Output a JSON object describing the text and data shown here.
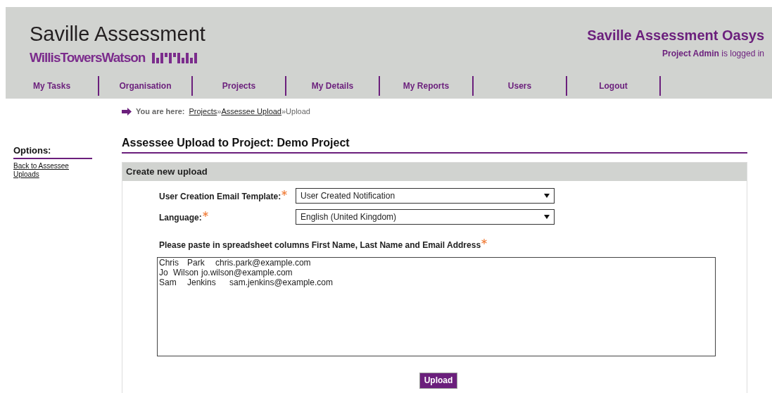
{
  "header": {
    "brand": "Saville Assessment",
    "sub_brand": "WillisTowersWatson",
    "product": "Saville Assessment Oasys",
    "user": "Project Admin",
    "user_suffix": "is logged in"
  },
  "nav": [
    {
      "label": "My Tasks"
    },
    {
      "label": "Organisation"
    },
    {
      "label": "Projects"
    },
    {
      "label": "My Details"
    },
    {
      "label": "My Reports"
    },
    {
      "label": "Users"
    },
    {
      "label": "Logout"
    }
  ],
  "breadcrumb": {
    "prefix": "You are here:",
    "links": [
      "Projects",
      "Assessee Upload"
    ],
    "current": "Upload",
    "separator": "»"
  },
  "sidebar": {
    "title": "Options:",
    "links": [
      "Back to Assessee Uploads"
    ]
  },
  "page_title": "Assessee Upload to Project: Demo Project",
  "panel": {
    "title": "Create new upload",
    "fields": [
      {
        "label": "User Creation Email Template:",
        "required": true,
        "value": "User Created Notification"
      },
      {
        "label": "Language:",
        "required": true,
        "value": "English (United Kingdom)"
      }
    ],
    "paste_label": "Please paste in spreadsheet columns First Name, Last Name and Email Address",
    "paste_required": true,
    "paste_value": "Chris\tPark\tchris.park@example.com\nJo\tWilson\tjo.wilson@example.com\nSam\tJenkins\tsam.jenkins@example.com",
    "button": "Upload"
  }
}
